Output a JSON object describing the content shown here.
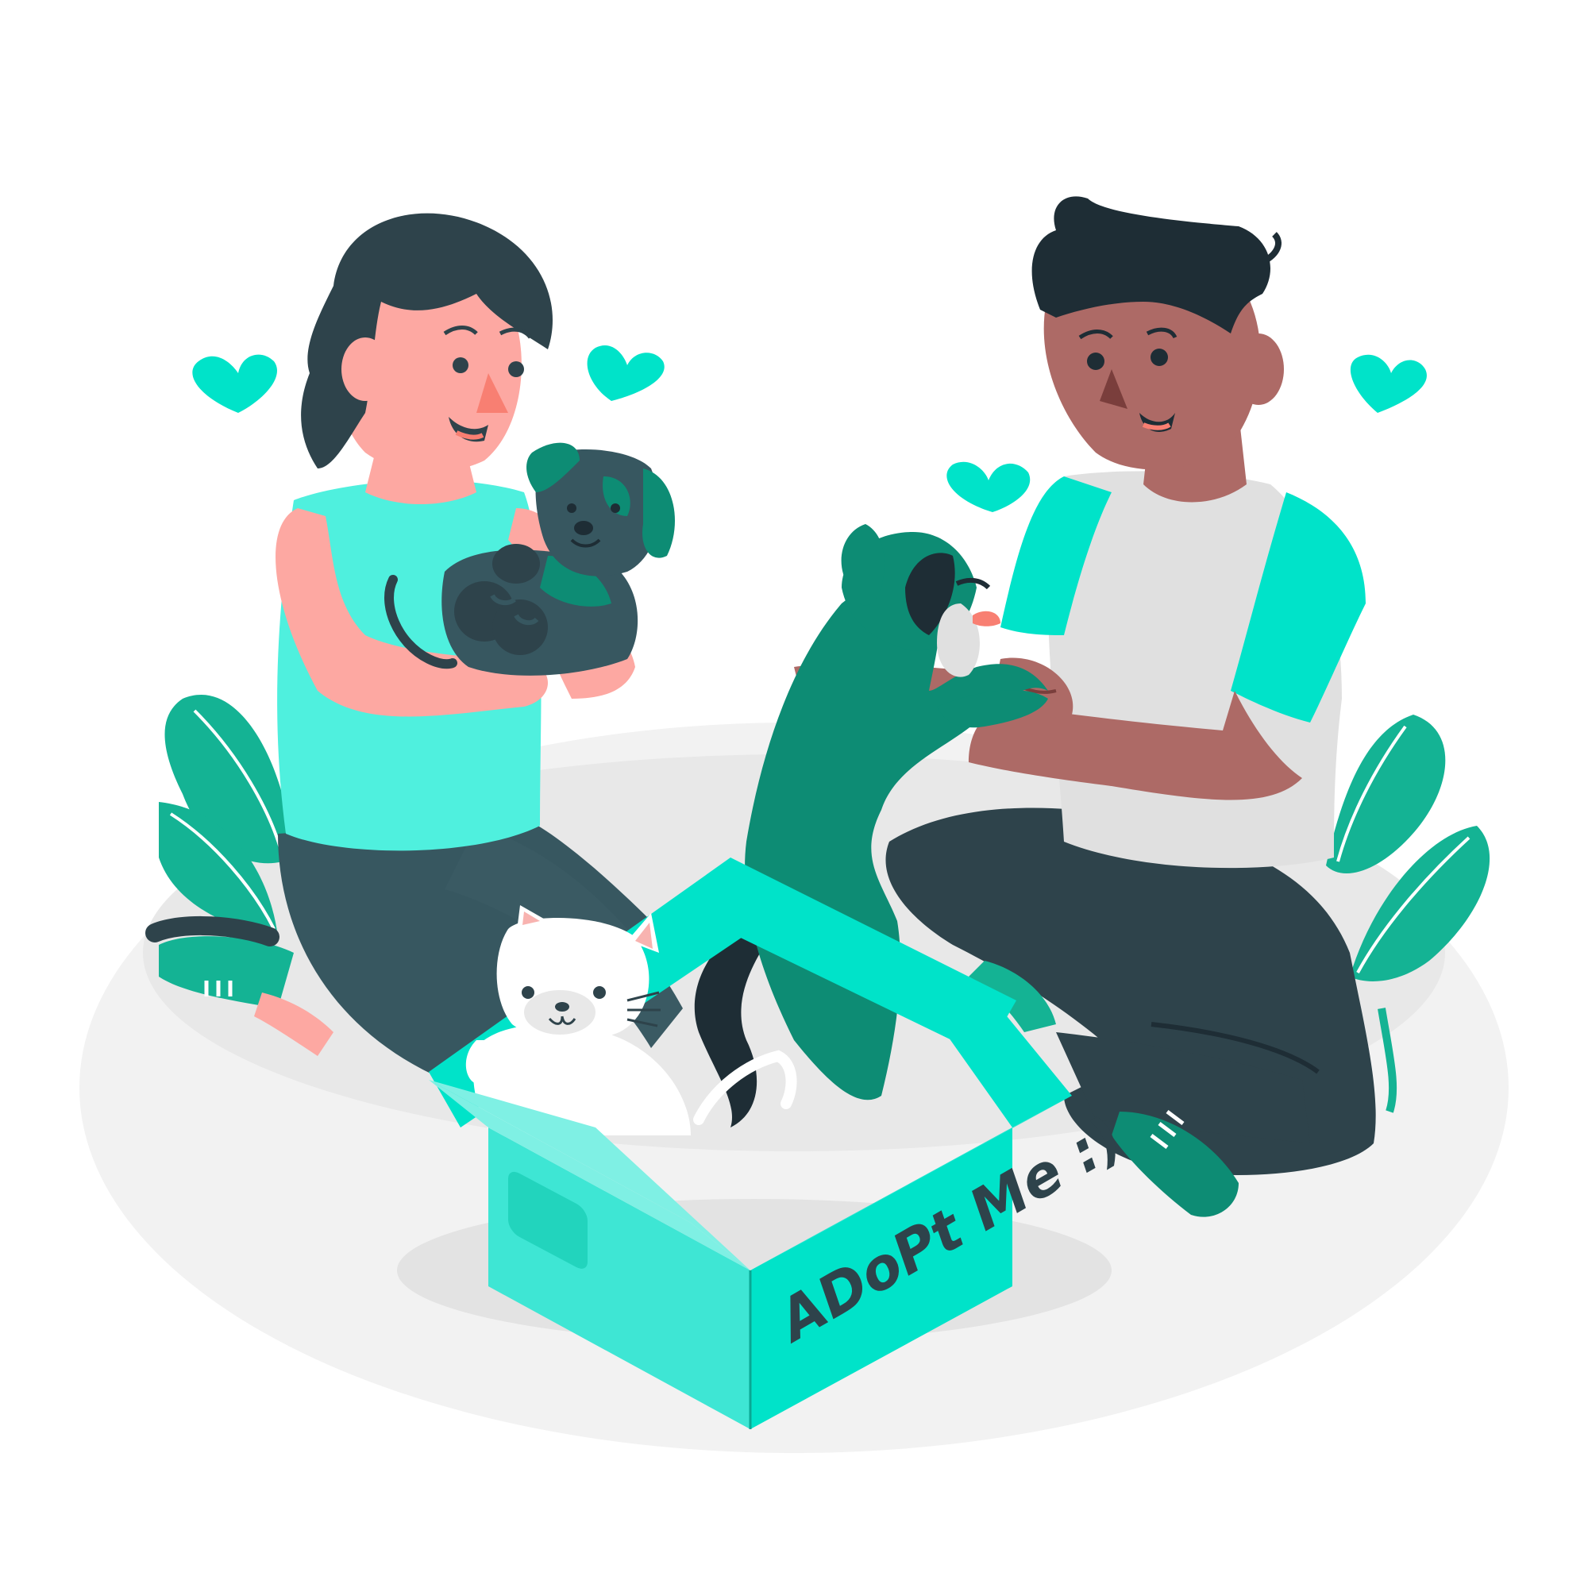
{
  "scene": {
    "box_label": "ADoPt Me :)"
  },
  "colors": {
    "background": "#ffffff",
    "ground": "#f2f2f2",
    "ground_shadow": "#e6e6e6",
    "teal": "#00e3c9",
    "teal_light": "#7ff0e4",
    "teal_dark": "#0d8c74",
    "plant": "#14b394",
    "dark": "#2e434b",
    "hair": "#1e2d35",
    "skin_light": "#fda8a2",
    "skin_dark": "#ad6a66",
    "shirt_grey": "#e0e0e0",
    "white": "#ffffff"
  },
  "icons": [
    "heart-icon",
    "plant-icon",
    "cat",
    "puppy",
    "dog",
    "cardboard-box"
  ]
}
